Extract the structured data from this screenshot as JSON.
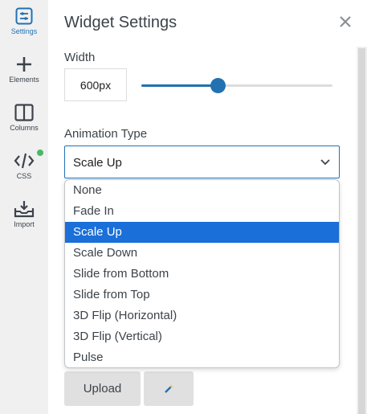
{
  "sidebar": {
    "items": [
      {
        "label": "Settings",
        "icon": "settings-sliders-icon",
        "active": true
      },
      {
        "label": "Elements",
        "icon": "plus-icon"
      },
      {
        "label": "Columns",
        "icon": "columns-icon"
      },
      {
        "label": "CSS",
        "icon": "code-icon",
        "status_dot": true
      },
      {
        "label": "Import",
        "icon": "import-tray-icon"
      }
    ]
  },
  "panel": {
    "title": "Widget Settings",
    "width_label": "Width",
    "width_value": "600px",
    "width_slider_fraction": 0.4,
    "animation_label": "Animation Type",
    "animation_selected": "Scale Up",
    "animation_options": [
      "None",
      "Fade In",
      "Scale Up",
      "Scale Down",
      "Slide from Bottom",
      "Slide from Top",
      "3D Flip (Horizontal)",
      "3D Flip (Vertical)",
      "Pulse"
    ],
    "upload_label": "Upload"
  },
  "colors": {
    "accent": "#2271b1",
    "selected_option": "#1a6fd8",
    "status_dot": "#4ab866"
  }
}
